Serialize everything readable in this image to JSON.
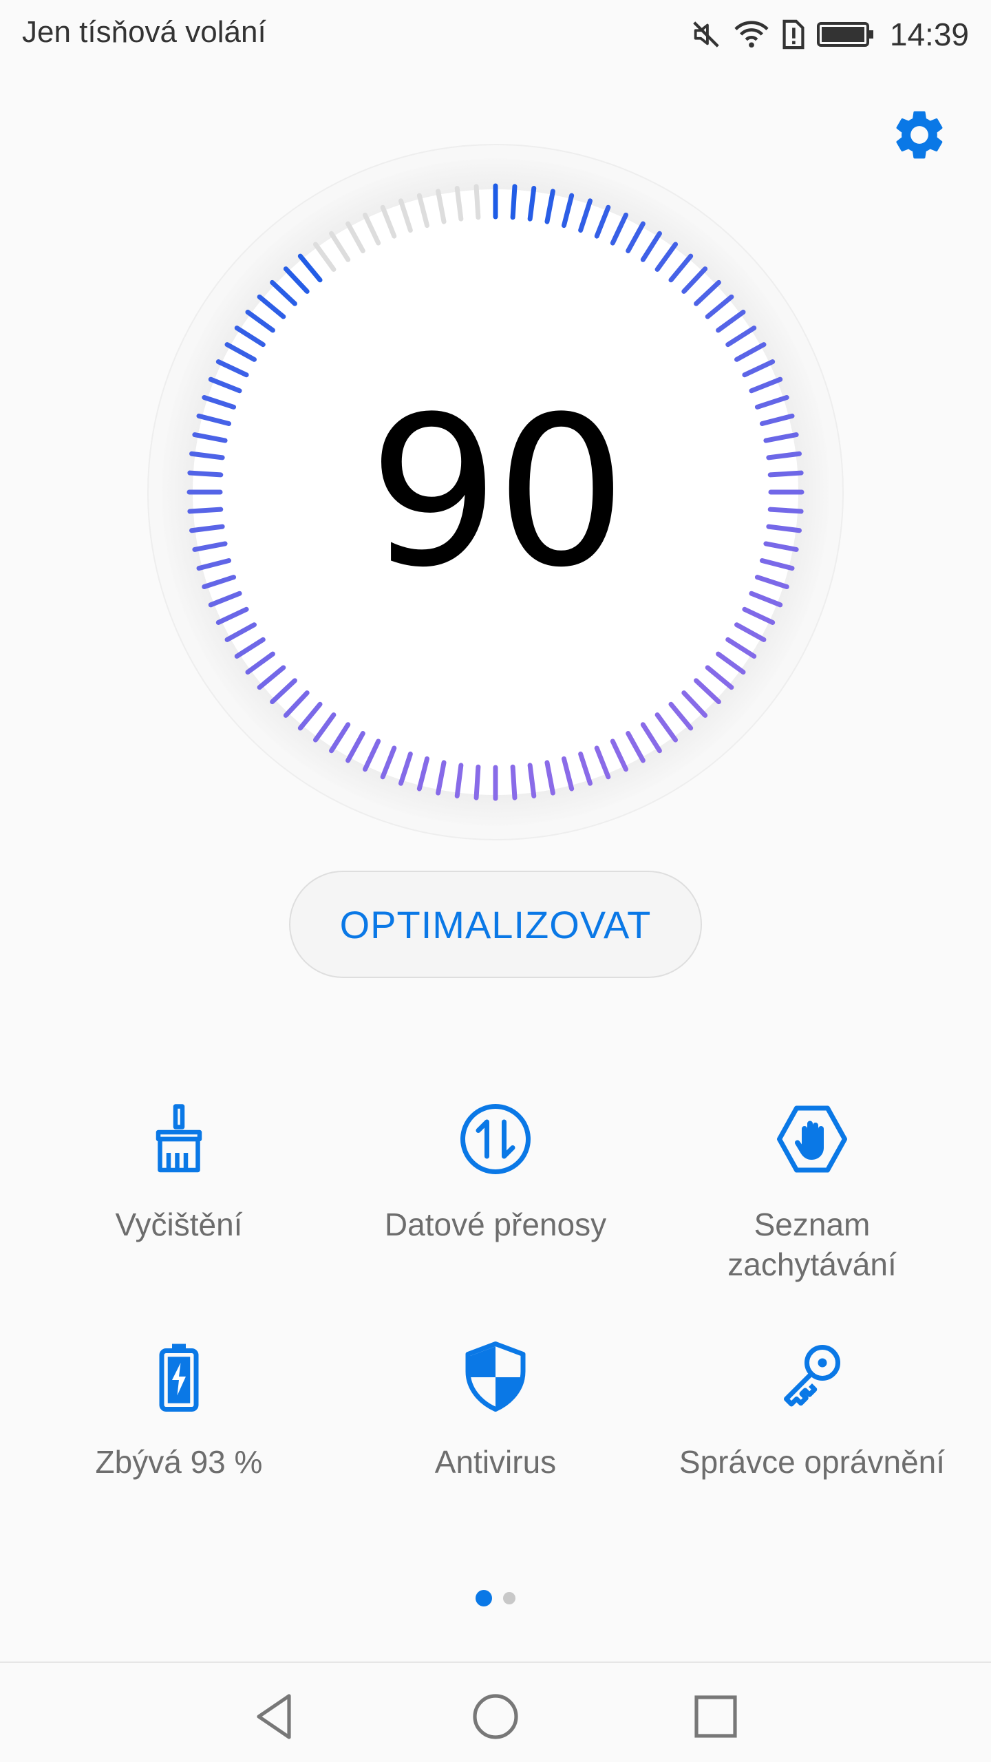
{
  "status_bar": {
    "carrier": "Jen tísňová volání",
    "time": "14:39",
    "icons": [
      "mute-icon",
      "wifi-icon",
      "sim-alert-icon",
      "battery-icon"
    ]
  },
  "score": {
    "value": "90",
    "max": 100
  },
  "optimize_button": {
    "label": "OPTIMALIZOVAT"
  },
  "tools": [
    {
      "label": "Vyčištění",
      "icon": "broom-icon"
    },
    {
      "label": "Datové přenosy",
      "icon": "data-transfer-icon"
    },
    {
      "label": "Seznam\nzachytávání",
      "icon": "block-hand-icon"
    },
    {
      "label": "Zbývá 93 %",
      "icon": "battery-charging-icon"
    },
    {
      "label": "Antivirus",
      "icon": "shield-icon"
    },
    {
      "label": "Správce oprávnění",
      "icon": "key-icon"
    }
  ],
  "pager": {
    "pages": 2,
    "active": 0
  },
  "navigation": {
    "buttons": [
      "back-icon",
      "home-icon",
      "recents-icon"
    ]
  },
  "colors": {
    "accent": "#0a78e6",
    "dial_start": "#1e5ce6",
    "dial_end": "#8a6be8",
    "dial_inactive": "#dddddd"
  }
}
